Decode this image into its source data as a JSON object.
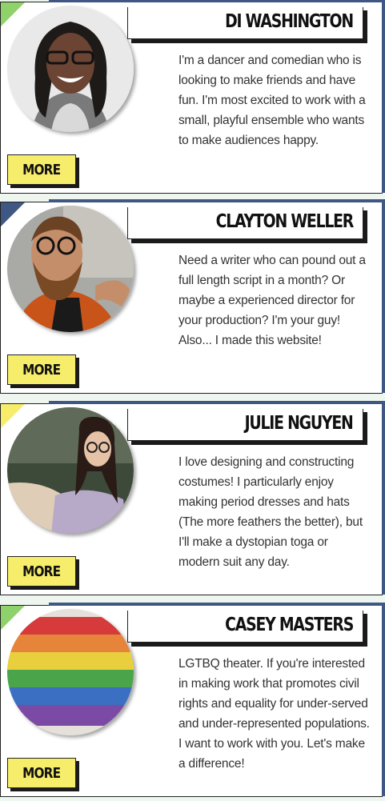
{
  "profiles": [
    {
      "name": "DI WASHINGTON",
      "bio": "I'm a dancer and comedian who is looking to make friends and have fun. I'm most excited to work with a small, playful ensemble who wants to make audiences happy.",
      "more_label": "MORE",
      "accent": "#8fd16a"
    },
    {
      "name": "CLAYTON WELLER",
      "bio": "Need a writer who can pound out a full length script in a month? Or maybe a experienced director for your production? I'm your guy! Also... I made this website!",
      "more_label": "MORE",
      "accent": "#3f5883"
    },
    {
      "name": "JULIE NGUYEN",
      "bio": "I love designing and constructing costumes! I particularly enjoy making period dresses and hats (The more feathers the better), but I'll make a dystopian toga or modern suit any day.",
      "more_label": "MORE",
      "accent": "#f6ed6b"
    },
    {
      "name": "CASEY MASTERS",
      "bio": "LGTBQ theater. If you're interested in making work that promotes civil rights and equality for under-served and under-represented populations. I want to work with you. Let's make a difference!",
      "more_label": "MORE",
      "accent": "#8fd16a"
    }
  ],
  "colors": {
    "button": "#f6ed6b",
    "border_blue": "#3f5883",
    "background": "#eef6ef"
  }
}
